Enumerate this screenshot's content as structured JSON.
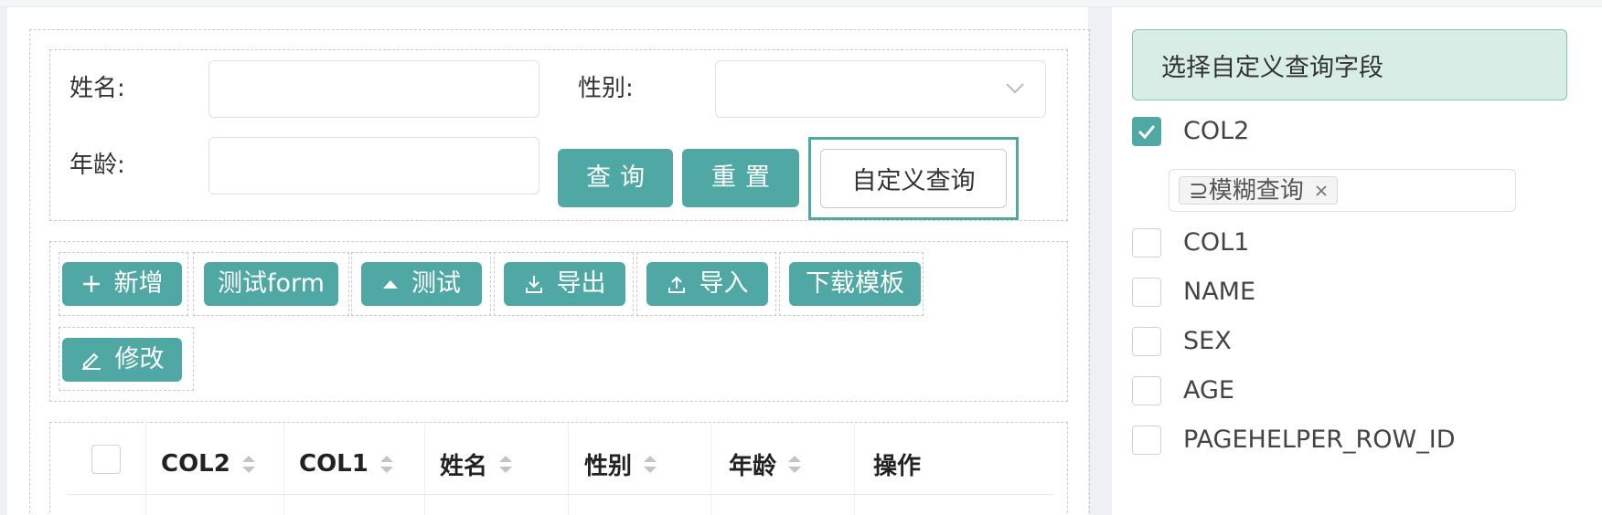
{
  "query_form": {
    "name_label": "姓名:",
    "gender_label": "性别:",
    "age_label": "年龄:",
    "name_value": "",
    "gender_value": "",
    "age_value": "",
    "query_button": "查询",
    "reset_button": "重置",
    "custom_query_button": "自定义查询"
  },
  "toolbar": {
    "add": "新增",
    "test_form": "测试form",
    "test": "测试",
    "export": "导出",
    "import": "导入",
    "download_template": "下载模板",
    "edit": "修改"
  },
  "table": {
    "columns": [
      "COL2",
      "COL1",
      "姓名",
      "性别",
      "年龄",
      "操作"
    ],
    "select_all_checked": false
  },
  "custom_fields": {
    "header": "选择自定义查询字段",
    "fields": [
      {
        "name": "COL2",
        "checked": true
      },
      {
        "name": "COL1",
        "checked": false
      },
      {
        "name": "NAME",
        "checked": false
      },
      {
        "name": "SEX",
        "checked": false
      },
      {
        "name": "AGE",
        "checked": false
      },
      {
        "name": "PAGEHELPER_ROW_ID",
        "checked": false
      }
    ],
    "col2_tag": "⊇模糊查询"
  },
  "colors": {
    "primary": "#4fa8a3",
    "header_bg": "#d8ede6",
    "header_border": "#7fcaa8"
  }
}
